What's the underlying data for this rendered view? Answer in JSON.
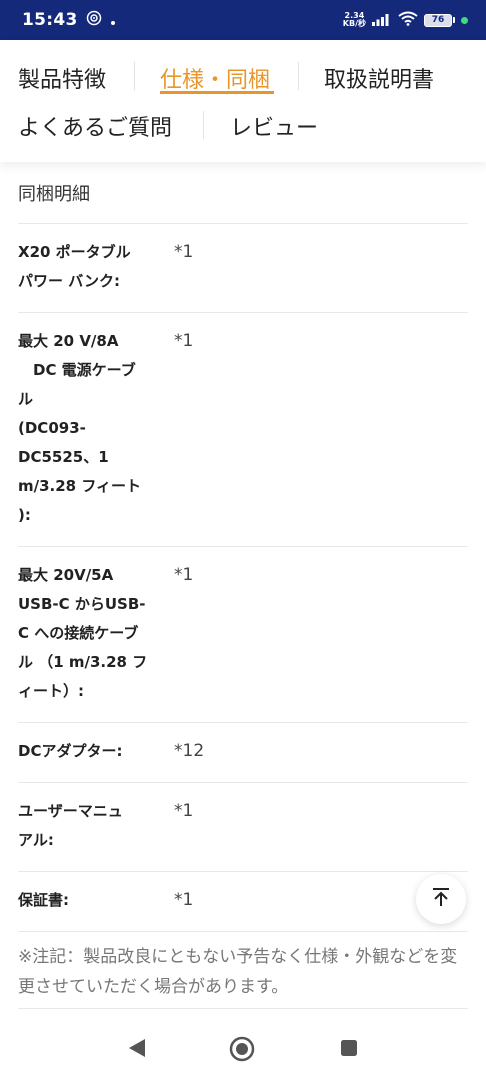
{
  "status": {
    "time": "15:43",
    "net_speed_value": "2.34",
    "net_speed_unit": "KB/秒",
    "battery": "76"
  },
  "tabs": [
    {
      "label": "製品特徴",
      "active": false
    },
    {
      "label": "仕様・同梱",
      "active": true
    },
    {
      "label": "取扱説明書",
      "active": false
    },
    {
      "label": "よくあるご質問",
      "active": false
    },
    {
      "label": "レビュー",
      "active": false
    }
  ],
  "section": {
    "title": "同梱明細"
  },
  "items": [
    {
      "label": "X20 ポータブル\nパワー バンク:",
      "value": "*1"
    },
    {
      "label": "最大 20 V/8A\n　DC 電源ケーブ\nル\n(DC093-\nDC5525、1\nm/3.28 フィート\n):",
      "value": "*1"
    },
    {
      "label": "最大 20V/5A\nUSB-C からUSB-\nC への接続ケーブ\nル （1 m/3.28 フ\nィート）:",
      "value": "*1"
    },
    {
      "label": "DCアダプター:",
      "value": "*12"
    },
    {
      "label": "ユーザーマニュ\nアル:",
      "value": "*1"
    },
    {
      "label": "保証書:",
      "value": "*1"
    }
  ],
  "note": "※注記：製品改良にともない予告なく仕様・外観などを変更させていただく場合があります。"
}
